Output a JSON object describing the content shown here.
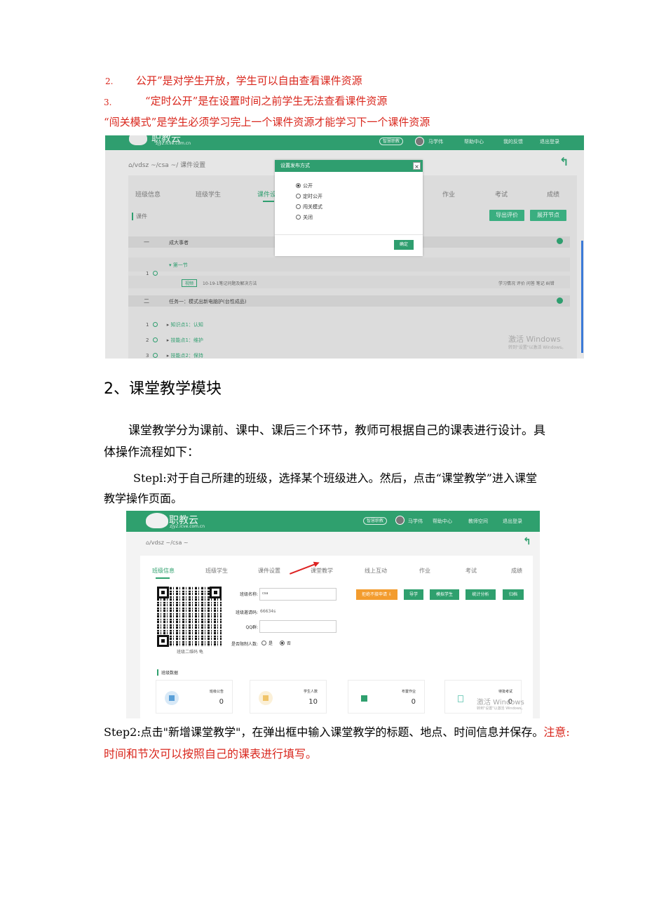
{
  "doc": {
    "item2_num": "2.",
    "item2_text": "公开”是对学生开放，学生可以自由查看课件资源",
    "item3_num": "3.",
    "item3_text": "“定时公开”是在设置时间之前学生无法查看课件资源",
    "item4_text": "“闯关模式”是学生必须学习完上一个课件资源才能学习下一个课件资源",
    "heading": "2、课堂教学模块",
    "para1_line1": "课堂教学分为课前、课中、课后三个环节，教师可根据自己的课表进行设计。具",
    "para1_line2": "体操作流程如下：",
    "step1_line1": "Stepl:对于自己所建的班级，选择某个班级进入。然后，点击“课堂教学”进入课堂",
    "step1_line2": "教学操作页面。",
    "step2_black": "Step2:点击\"新增课堂教学\"，在弹出框中输入课堂教学的标题、地点、时间信息并保存。",
    "step2_red1": "注意:",
    "step2_red2": "时间和节次可以按照自己的课表进行填写。"
  },
  "shot1": {
    "logo": "职教云",
    "logo_sub": "zjy2.icve.com.cn",
    "topbar": {
      "pill": "智慧职教",
      "user": "马学伟",
      "help": "帮助中心",
      "feedback": "我的反馈",
      "logout": "退出登录"
    },
    "breadcrumb": "/vdsz ~/csa ~/ 课件设置",
    "tabs": [
      "班级信息",
      "班级学生",
      "课件设",
      "作业",
      "考试",
      "成绩"
    ],
    "section": "课件",
    "buttons": {
      "export": "导出评价",
      "expand": "展开节点"
    },
    "rows": [
      {
        "col1": "一",
        "col2": "成大事者"
      },
      {
        "col1": "二",
        "col2": "任务一：模式出新电脑护(台性成品)"
      }
    ],
    "node_section": "第一节",
    "node_section_num": "1",
    "video_tag": "视频",
    "video_title": "10-19-1笔记问题及解决方法",
    "row_actions": "学习情况 评价 问答 笔记 纠错",
    "nodes": [
      {
        "num": "1",
        "label": "知识点1：认知"
      },
      {
        "num": "2",
        "label": "技能点1：维护"
      },
      {
        "num": "3",
        "label": "技能点2：保持"
      }
    ],
    "watermark1": "激活 Windows",
    "watermark2": "转到\"设置\"以激活 Windows。",
    "modal": {
      "title": "设置发布方式",
      "close": "×",
      "options": [
        "公开",
        "定时公开",
        "闯关模式",
        "关闭"
      ],
      "selected": "公开",
      "ok": "确定"
    }
  },
  "shot2": {
    "logo": "职教云",
    "logo_sub": "zjy2.icve.com.cn",
    "topbar": {
      "pill": "智慧职教",
      "user": "马学伟",
      "help": "帮助中心",
      "resources": "教师空间",
      "logout": "退出登录"
    },
    "breadcrumb": "/vdsz ~/csa ~",
    "tabs": [
      "班级信息",
      "班级学生",
      "课件设置",
      "课堂教学",
      "线上互动",
      "作业",
      "考试",
      "成绩"
    ],
    "qr_caption": "班级二维码 龟",
    "form": {
      "name_label": "班级名称:",
      "name_value": "csa",
      "code_label": "班级邀请码:",
      "code_value": "66634s",
      "qq_label": "QQ群:",
      "limit_label": "是否限制人数:",
      "limit_yes": "是",
      "limit_no": "否"
    },
    "buttons": {
      "orange": "拒绝不接申请 ⇩",
      "b1": "导学",
      "b2": "模拟学生",
      "b3": "统计分析",
      "b4": "归档"
    },
    "stats_title": "班级数据",
    "cards": [
      {
        "label": "班级公告",
        "value": "0",
        "color": "#5aa0d8"
      },
      {
        "label": "学生人数",
        "value": "10",
        "color": "#f0c46a"
      },
      {
        "label": "布置作业",
        "value": "0",
        "color": "#2fa06e"
      },
      {
        "label": "待批考试",
        "value": "0",
        "color": "#7fd0c0"
      }
    ],
    "watermark1": "激活 Windows",
    "watermark2": "转到\"设置\"以激活 Windows。"
  }
}
